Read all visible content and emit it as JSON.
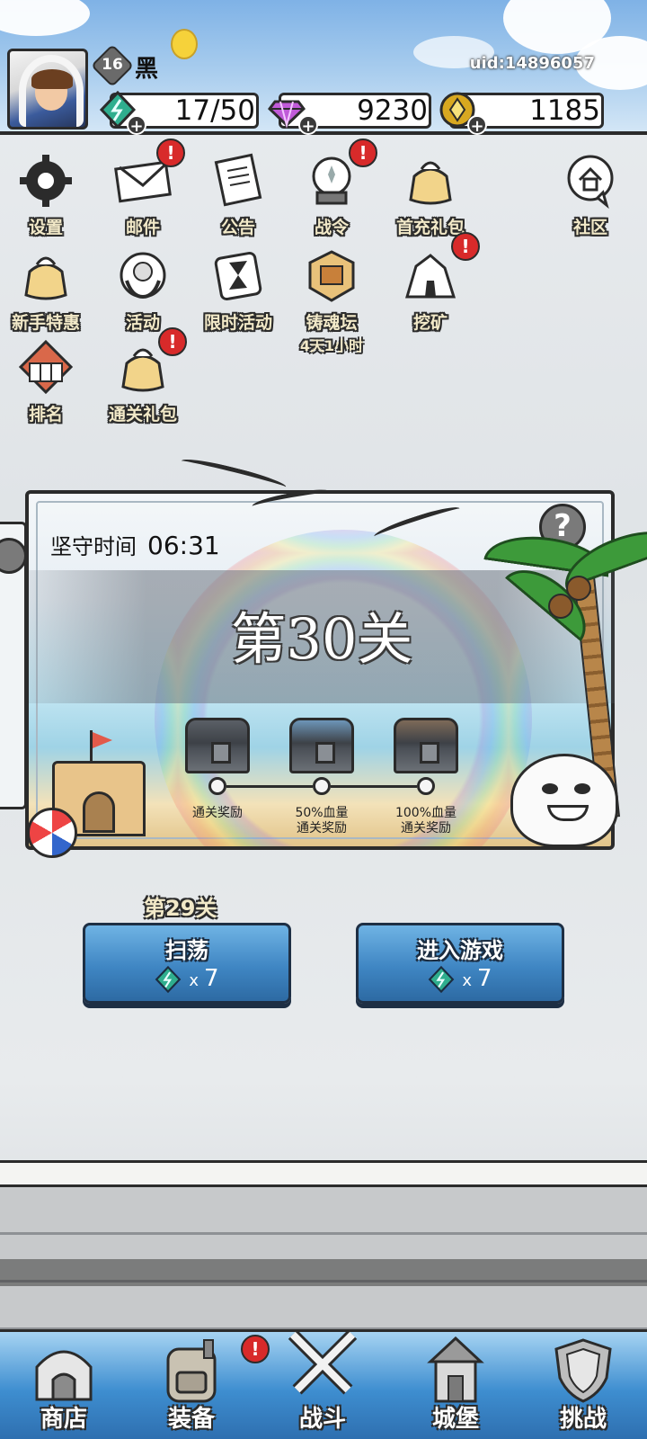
{
  "player": {
    "level": "16",
    "name": "黑",
    "uid": "uid:14896057"
  },
  "resources": {
    "energy": "17/50",
    "gems": "9230",
    "gold": "1185"
  },
  "menu": {
    "settings": "设置",
    "mail": "邮件",
    "notice": "公告",
    "battle_pass": "战令",
    "first_recharge": "首充礼包",
    "community": "社区",
    "newbie_deal": "新手特惠",
    "events": "活动",
    "limited_event": "限时活动",
    "soul_altar": "铸魂坛",
    "soul_altar_timer": "4天1小时",
    "mining": "挖矿",
    "ranking": "排名",
    "clear_pack": "通关礼包",
    "alert_mark": "!"
  },
  "stage": {
    "guard_label": "坚守时间",
    "guard_time": "06:31",
    "title": "第30关",
    "help": "?",
    "rewards": [
      {
        "label_line1": "通关奖励",
        "label_line2": ""
      },
      {
        "label_line1": "50%血量",
        "label_line2": "通关奖励"
      },
      {
        "label_line1": "100%血量",
        "label_line2": "通关奖励"
      }
    ]
  },
  "actions": {
    "prev_stage": "第29关",
    "sweep_label": "扫荡",
    "sweep_cost_x": "x",
    "sweep_cost": "7",
    "enter_label": "进入游戏",
    "enter_cost_x": "x",
    "enter_cost": "7"
  },
  "nav": {
    "shop": "商店",
    "equipment": "装备",
    "battle": "战斗",
    "castle": "城堡",
    "challenge": "挑战"
  },
  "colors": {
    "alert": "#d82a2a",
    "button_blue": "#3f86c3",
    "energy": "#2fae8e",
    "gem": "#c05ad8",
    "gold": "#d8a820"
  }
}
